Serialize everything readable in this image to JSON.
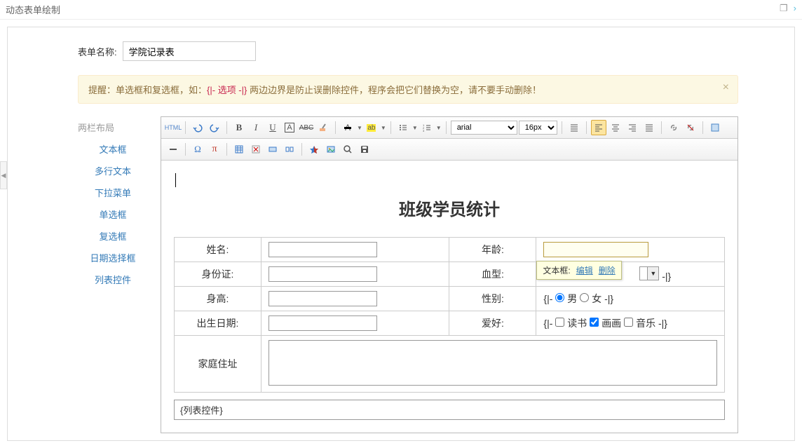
{
  "header": {
    "title": "动态表单绘制"
  },
  "form_name": {
    "label": "表单名称:",
    "value": "学院记录表"
  },
  "alert": {
    "prefix": "提醒：",
    "text1": "单选框和复选框，如：",
    "code": "{|- 选项 -|}",
    "text2": " 两边边界是防止误删除控件，程序会把它们替换为空，请不要手动删除！"
  },
  "sidebar": {
    "title": "两栏布局",
    "items": [
      "文本框",
      "多行文本",
      "下拉菜单",
      "单选框",
      "复选框",
      "日期选择框",
      "列表控件"
    ]
  },
  "toolbar": {
    "html": "HTML",
    "font": "arial",
    "size": "16px"
  },
  "content": {
    "title": "班级学员统计",
    "rows": [
      {
        "l1": "姓名:",
        "l2": "年龄:"
      },
      {
        "l1": "身份证:",
        "l2": "血型:"
      },
      {
        "l1": "身高:",
        "l2": "性别:"
      },
      {
        "l1": "出生日期:",
        "l2": "爱好:"
      }
    ],
    "gender": {
      "prefix": "{|- ",
      "opt1": "男",
      "opt2": "女",
      "suffix": " -|}"
    },
    "hobby": {
      "prefix": "{|- ",
      "opt1": "读书",
      "opt2": "画画",
      "opt3": "音乐",
      "suffix": " -|}"
    },
    "blood_suffix": "  -|}",
    "address_label": "家庭住址",
    "list_placeholder": "{列表控件}"
  },
  "tooltip": {
    "label": "文本框:",
    "edit": "编辑",
    "delete": "删除"
  }
}
